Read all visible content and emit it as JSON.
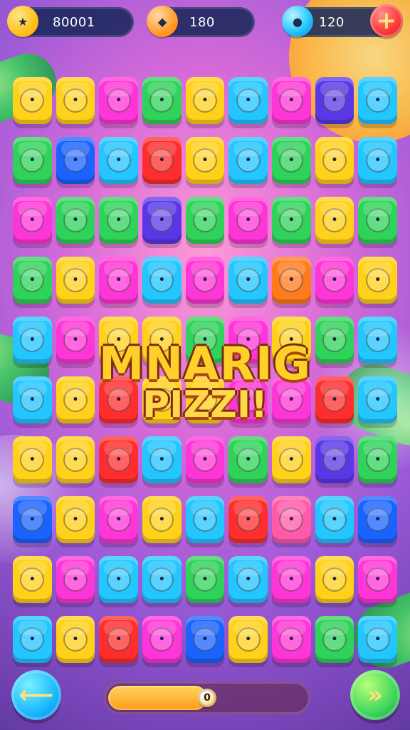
{
  "hud": {
    "score": {
      "icon": "star-icon",
      "value": "80001"
    },
    "gems": {
      "icon": "gem-icon",
      "value": "180"
    },
    "coins": {
      "icon": "drop-icon",
      "value": "120"
    },
    "add_button_icon": "plus-icon"
  },
  "title": {
    "line1": "MNARIG",
    "line2": "PIZZI!"
  },
  "board": {
    "rows": [
      [
        "yellow",
        "yellow",
        "magenta",
        "green",
        "yellow",
        "cyan",
        "magenta",
        "purple",
        "cyan"
      ],
      [
        "green",
        "blue",
        "cyan",
        "red",
        "yellow",
        "cyan",
        "green",
        "yellow",
        "cyan"
      ],
      [
        "magenta",
        "green",
        "green",
        "purple",
        "green",
        "magenta",
        "green",
        "yellow",
        "green"
      ],
      [
        "green",
        "yellow",
        "magenta",
        "cyan",
        "magenta",
        "cyan",
        "orange",
        "magenta",
        "yellow"
      ],
      [
        "cyan",
        "magenta",
        "yellow",
        "yellow",
        "green",
        "magenta",
        "yellow",
        "green",
        "cyan"
      ],
      [
        "cyan",
        "yellow",
        "red",
        "yellow",
        "yellow",
        "magenta",
        "magenta",
        "red",
        "cyan"
      ],
      [
        "yellow",
        "yellow",
        "red",
        "cyan",
        "magenta",
        "green",
        "yellow",
        "purple",
        "green"
      ],
      [
        "blue",
        "yellow",
        "magenta",
        "yellow",
        "cyan",
        "red",
        "pink",
        "cyan",
        "blue"
      ],
      [
        "yellow",
        "magenta",
        "cyan",
        "cyan",
        "green",
        "cyan",
        "magenta",
        "yellow",
        "magenta"
      ],
      [
        "cyan",
        "yellow",
        "red",
        "magenta",
        "blue",
        "yellow",
        "magenta",
        "green",
        "cyan"
      ]
    ]
  },
  "controls": {
    "left_icon": "arrow-left-icon",
    "right_icon": "fast-forward-icon",
    "progress_label": "0",
    "progress_fraction": 0.5
  },
  "colors": {
    "yellow": "#ffd11a",
    "green": "#2fd35a",
    "magenta": "#ff36d7",
    "cyan": "#23c6ff",
    "purple": "#5a37e6",
    "red": "#ff2e2e",
    "blue": "#1a63ff",
    "orange": "#ff7a1c",
    "pink": "#ff5aa9"
  }
}
